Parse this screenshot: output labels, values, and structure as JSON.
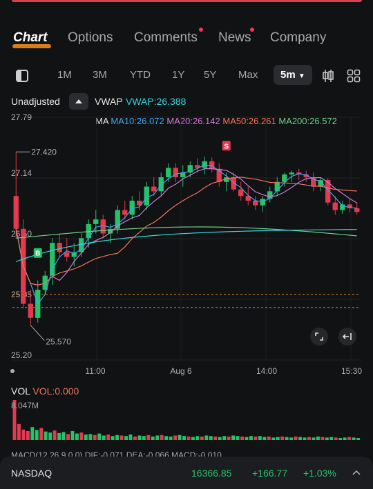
{
  "tabs": [
    {
      "label": "Chart",
      "active": true,
      "dot": false
    },
    {
      "label": "Options",
      "active": false,
      "dot": false
    },
    {
      "label": "Comments",
      "active": false,
      "dot": true
    },
    {
      "label": "News",
      "active": false,
      "dot": true
    },
    {
      "label": "Company",
      "active": false,
      "dot": false
    }
  ],
  "ranges": [
    "1M",
    "3M",
    "YTD",
    "1Y",
    "5Y",
    "Max"
  ],
  "interval": "5m",
  "header": {
    "adjust_label": "Unadjusted",
    "vwap_label": "VWAP",
    "vwap_value": "VWAP:26.388"
  },
  "ma_legend": {
    "label": "MA",
    "ma10": "MA10:26.072",
    "ma20": "MA20:26.142",
    "ma50": "MA50:26.261",
    "ma200": "MA200:26.572"
  },
  "colors": {
    "up": "#25c26a",
    "down": "#e5394f",
    "ma10": "#3fa6f0",
    "ma20": "#d27ad4",
    "ma50": "#f0735e",
    "ma200": "#6fd08a",
    "vwap": "#35d6e0"
  },
  "chart_data": {
    "type": "candlestick",
    "y_ticks": [
      "27.79",
      "27.14",
      "26.50",
      "25.85",
      "25.20"
    ],
    "x_ticks": [
      "11:00",
      "Aug 6",
      "14:00",
      "15:30"
    ],
    "ylim": [
      25.2,
      27.79
    ],
    "annotations": {
      "high": "27.420",
      "low": "25.570",
      "buy_marker": "B",
      "sell_marker": "S"
    },
    "candles": [
      {
        "o": 26.95,
        "h": 27.42,
        "l": 26.5,
        "c": 26.6
      },
      {
        "o": 26.6,
        "h": 26.7,
        "l": 25.75,
        "c": 25.8
      },
      {
        "o": 25.8,
        "h": 25.95,
        "l": 25.57,
        "c": 25.65
      },
      {
        "o": 25.65,
        "h": 26.05,
        "l": 25.6,
        "c": 25.95
      },
      {
        "o": 25.95,
        "h": 26.15,
        "l": 25.9,
        "c": 26.1
      },
      {
        "o": 26.1,
        "h": 26.5,
        "l": 26.0,
        "c": 26.45
      },
      {
        "o": 26.45,
        "h": 26.55,
        "l": 26.3,
        "c": 26.35
      },
      {
        "o": 26.35,
        "h": 26.5,
        "l": 26.25,
        "c": 26.3
      },
      {
        "o": 26.3,
        "h": 26.45,
        "l": 26.2,
        "c": 26.35
      },
      {
        "o": 26.35,
        "h": 26.55,
        "l": 26.3,
        "c": 26.5
      },
      {
        "o": 26.5,
        "h": 26.7,
        "l": 26.4,
        "c": 26.65
      },
      {
        "o": 26.65,
        "h": 26.8,
        "l": 26.55,
        "c": 26.7
      },
      {
        "o": 26.7,
        "h": 26.75,
        "l": 26.5,
        "c": 26.55
      },
      {
        "o": 26.55,
        "h": 26.65,
        "l": 26.45,
        "c": 26.6
      },
      {
        "o": 26.6,
        "h": 26.85,
        "l": 26.55,
        "c": 26.8
      },
      {
        "o": 26.8,
        "h": 26.9,
        "l": 26.7,
        "c": 26.75
      },
      {
        "o": 26.75,
        "h": 26.95,
        "l": 26.7,
        "c": 26.9
      },
      {
        "o": 26.9,
        "h": 27.0,
        "l": 26.8,
        "c": 26.85
      },
      {
        "o": 26.85,
        "h": 27.1,
        "l": 26.8,
        "c": 27.05
      },
      {
        "o": 27.05,
        "h": 27.15,
        "l": 26.95,
        "c": 27.0
      },
      {
        "o": 27.0,
        "h": 27.2,
        "l": 26.95,
        "c": 27.15
      },
      {
        "o": 27.15,
        "h": 27.3,
        "l": 27.1,
        "c": 27.25
      },
      {
        "o": 27.25,
        "h": 27.3,
        "l": 27.1,
        "c": 27.15
      },
      {
        "o": 27.15,
        "h": 27.28,
        "l": 27.05,
        "c": 27.2
      },
      {
        "o": 27.2,
        "h": 27.32,
        "l": 27.15,
        "c": 27.28
      },
      {
        "o": 27.28,
        "h": 27.35,
        "l": 27.2,
        "c": 27.25
      },
      {
        "o": 27.25,
        "h": 27.37,
        "l": 27.18,
        "c": 27.32
      },
      {
        "o": 27.32,
        "h": 27.36,
        "l": 27.2,
        "c": 27.24
      },
      {
        "o": 27.24,
        "h": 27.3,
        "l": 27.05,
        "c": 27.1
      },
      {
        "o": 27.1,
        "h": 27.2,
        "l": 27.0,
        "c": 27.15
      },
      {
        "o": 27.15,
        "h": 27.2,
        "l": 27.0,
        "c": 27.02
      },
      {
        "o": 27.02,
        "h": 27.1,
        "l": 26.9,
        "c": 26.95
      },
      {
        "o": 26.95,
        "h": 27.05,
        "l": 26.85,
        "c": 26.9
      },
      {
        "o": 26.9,
        "h": 26.95,
        "l": 26.8,
        "c": 26.85
      },
      {
        "o": 26.85,
        "h": 26.95,
        "l": 26.78,
        "c": 26.92
      },
      {
        "o": 26.92,
        "h": 27.05,
        "l": 26.88,
        "c": 27.0
      },
      {
        "o": 27.0,
        "h": 27.15,
        "l": 26.95,
        "c": 27.1
      },
      {
        "o": 27.1,
        "h": 27.2,
        "l": 27.05,
        "c": 27.18
      },
      {
        "o": 27.18,
        "h": 27.22,
        "l": 27.1,
        "c": 27.2
      },
      {
        "o": 27.2,
        "h": 27.24,
        "l": 27.12,
        "c": 27.18
      },
      {
        "o": 27.18,
        "h": 27.22,
        "l": 27.1,
        "c": 27.15
      },
      {
        "o": 27.15,
        "h": 27.2,
        "l": 27.0,
        "c": 27.05
      },
      {
        "o": 27.05,
        "h": 27.15,
        "l": 27.0,
        "c": 27.12
      },
      {
        "o": 27.12,
        "h": 27.14,
        "l": 26.85,
        "c": 26.88
      },
      {
        "o": 26.88,
        "h": 26.95,
        "l": 26.75,
        "c": 26.8
      },
      {
        "o": 26.8,
        "h": 26.9,
        "l": 26.76,
        "c": 26.86
      },
      {
        "o": 26.86,
        "h": 26.92,
        "l": 26.78,
        "c": 26.82
      },
      {
        "o": 26.82,
        "h": 26.88,
        "l": 26.75,
        "c": 26.78
      }
    ]
  },
  "volume": {
    "label": "VOL",
    "value": "VOL:0.000",
    "max_label": "8.047M",
    "bars": [
      8.0,
      3.2,
      2.1,
      1.8,
      2.6,
      2.0,
      2.4,
      1.7,
      1.5,
      1.9,
      1.4,
      1.6,
      1.2,
      1.8,
      1.3,
      1.5,
      1.1,
      1.2,
      1.0,
      1.3,
      0.9,
      1.1,
      0.8,
      1.0,
      0.9,
      0.8,
      1.1,
      0.7,
      0.9,
      0.8,
      1.0,
      0.7,
      0.9,
      1.0,
      0.8,
      0.7,
      0.9,
      1.0,
      0.8,
      0.7,
      0.6,
      0.8,
      0.7,
      0.9,
      0.8,
      0.7,
      0.6,
      0.8,
      0.7,
      0.9,
      0.8,
      0.7,
      0.6,
      0.8,
      0.7,
      0.8,
      0.6,
      0.7,
      0.5,
      0.6,
      0.7,
      0.6,
      0.5,
      0.7,
      0.6,
      0.5,
      0.6,
      0.5,
      0.7,
      0.6,
      0.5,
      0.6,
      0.5,
      0.4,
      0.5,
      0.6,
      0.5,
      0.4
    ]
  },
  "macd_text": "MACD(12,26,9,0,0) DIF:-0.071 DEA:-0.066 MACD:-0.010",
  "footer": {
    "index": "NASDAQ",
    "price": "16366.85",
    "change": "+166.77",
    "percent": "+1.03%"
  }
}
